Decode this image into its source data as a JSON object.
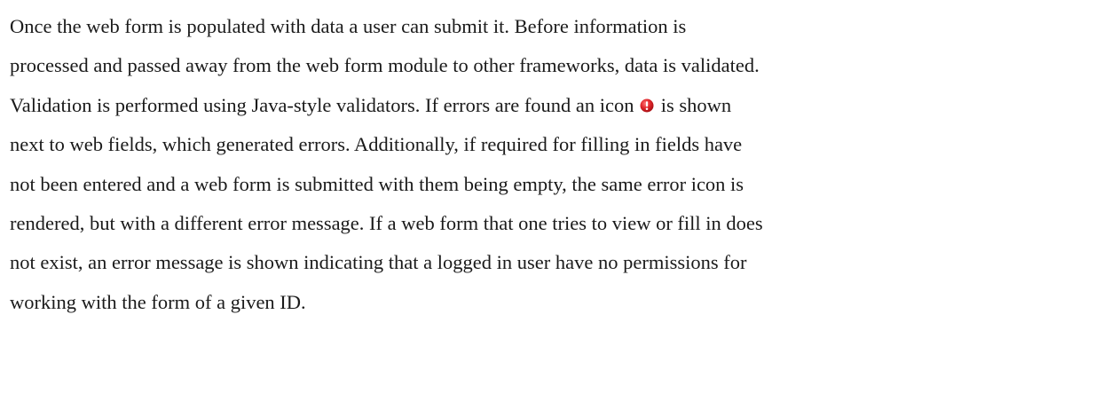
{
  "document": {
    "paragraph": {
      "lines": [
        "Once the web form is populated with data a user can submit it. Before information is",
        "processed and passed away from the web form module to other frameworks, data is validated.",
        "Validation is performed using Java-style validators. If errors are found an icon",
        "is shown",
        "next to web fields, which generated errors. Additionally, if required for filling in fields have",
        "not been entered and a web form is submitted with them being empty, the same error icon is",
        "rendered, but with a different error message. If a web form that one tries to view or fill in does",
        "not exist, an error message is shown indicating that a logged in user have no permissions for",
        "working with the form of a given ID."
      ]
    },
    "inline_icon": {
      "icon": "error-icon",
      "color": "#e0262b"
    }
  }
}
